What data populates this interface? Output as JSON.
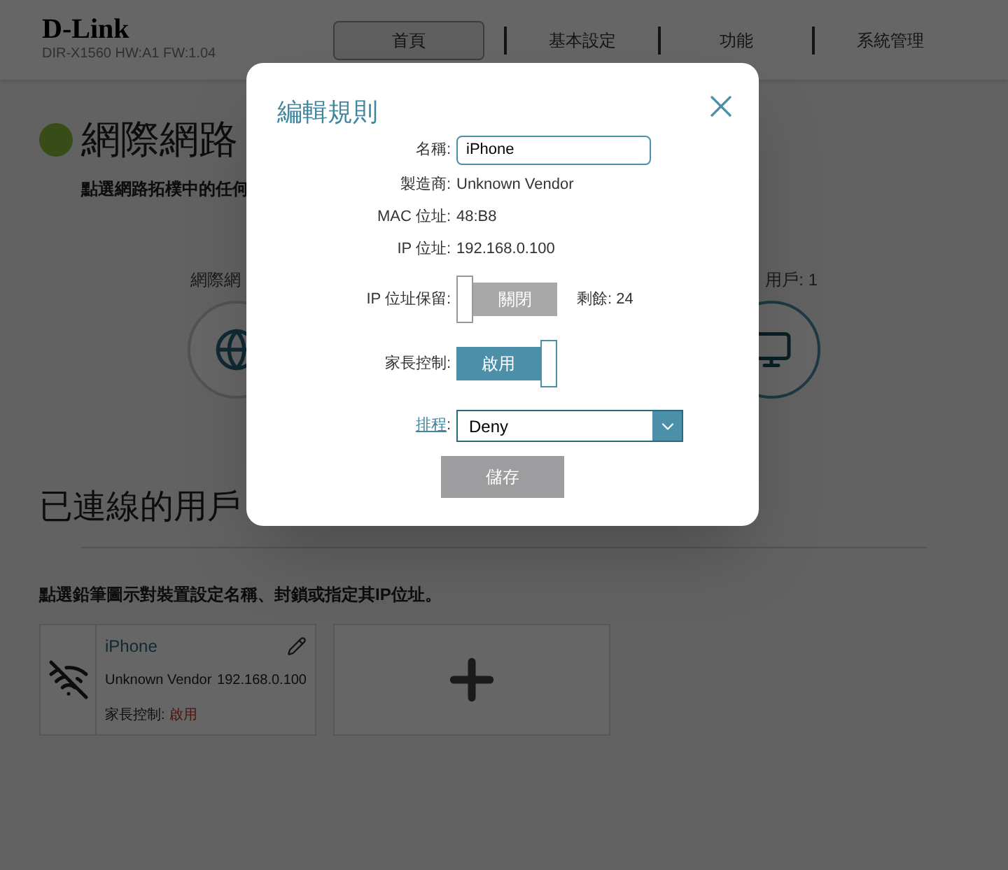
{
  "header": {
    "logo": "D-Link",
    "model": "DIR-X1560 HW:A1 FW:1.04"
  },
  "nav": [
    {
      "label": "首頁",
      "selected": true
    },
    {
      "label": "基本設定",
      "selected": false
    },
    {
      "label": "功能",
      "selected": false
    },
    {
      "label": "系統管理",
      "selected": false
    }
  ],
  "internet": {
    "title": "網際網路",
    "hint": "點選網路拓樸中的任何",
    "left_label": "網際網",
    "right_label": "用戶: 1"
  },
  "clients": {
    "title": "已連線的用戶",
    "hint": "點選鉛筆圖示對裝置設定名稱、封鎖或指定其IP位址。",
    "cards": [
      {
        "name": "iPhone",
        "vendor": "Unknown Vendor",
        "ip": "192.168.0.100",
        "parental_label": "家長控制:",
        "parental_value": "啟用"
      }
    ]
  },
  "dialog": {
    "title": "編輯規則",
    "name_label": "名稱:",
    "name_value": "iPhone",
    "vendor_label": "製造商:",
    "vendor_value": "Unknown Vendor",
    "mac_label": "MAC 位址:",
    "mac_value": "48:B8",
    "ip_label": "IP 位址:",
    "ip_value": "192.168.0.100",
    "reserve": {
      "label": "IP 位址保留:",
      "text": "關閉",
      "on": false,
      "remaining": "剩餘: 24"
    },
    "parental": {
      "label": "家長控制:",
      "text": "啟用",
      "on": true
    },
    "schedule_label": "排程",
    "schedule_colon": ":",
    "schedule_value": "Deny",
    "save": "儲存"
  }
}
